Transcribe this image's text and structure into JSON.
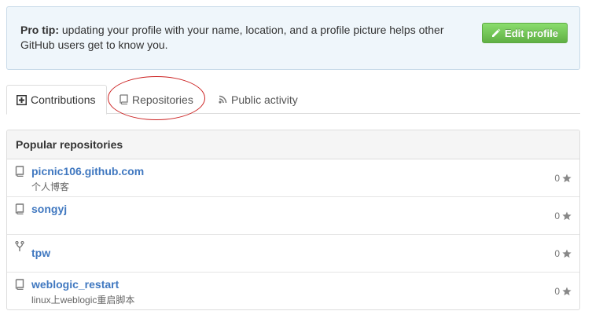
{
  "protip": {
    "label": "Pro tip:",
    "text": " updating your profile with your name, location, and a profile picture helps other GitHub users get to know you.",
    "edit_button": "Edit profile"
  },
  "tabs": [
    {
      "label": "Contributions",
      "icon": "plus-square-icon",
      "selected": true
    },
    {
      "label": "Repositories",
      "icon": "repo-icon",
      "selected": false
    },
    {
      "label": "Public activity",
      "icon": "rss-icon",
      "selected": false
    }
  ],
  "popular": {
    "title": "Popular repositories",
    "repos": [
      {
        "name": "picnic106.github.com",
        "description": "个人博客",
        "stars": "0",
        "icon": "repo-icon"
      },
      {
        "name": "songyj",
        "description": "",
        "stars": "0",
        "icon": "repo-icon"
      },
      {
        "name": "tpw",
        "description": "",
        "stars": "0",
        "icon": "fork-icon"
      },
      {
        "name": "weblogic_restart",
        "description": "linux上weblogic重启脚本",
        "stars": "0",
        "icon": "repo-icon"
      }
    ]
  },
  "colors": {
    "link": "#4078c0",
    "button_green": "#60b044",
    "annotation_red": "#cc2222",
    "protip_bg": "#eff6fb"
  }
}
